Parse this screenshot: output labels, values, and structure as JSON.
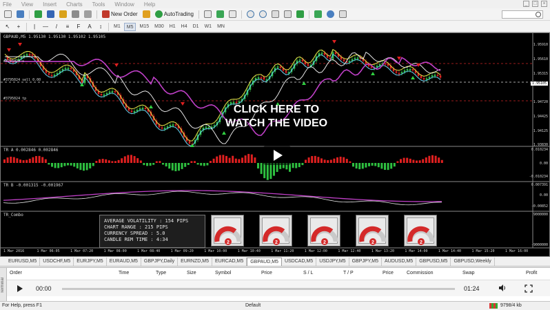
{
  "menu": [
    "File",
    "View",
    "Insert",
    "Charts",
    "Tools",
    "Window",
    "Help"
  ],
  "toolbar": {
    "new_order": "New Order",
    "auto_trading": "AutoTrading",
    "timeframes": [
      "M1",
      "M5",
      "M15",
      "M30",
      "H1",
      "H4",
      "D1",
      "W1",
      "MN"
    ]
  },
  "chart": {
    "title": "GBPAUD,M5 1.95130 1.95130 1.95102 1.95105",
    "order_labels": [
      "#3795024 s",
      "#3795024 sell 0.00",
      "#3795024 tp"
    ],
    "price_axis": [
      "1.95910",
      "1.95610",
      "1.95315",
      "1.95105",
      "1.94720",
      "1.94425",
      "1.94125",
      "1.93830"
    ],
    "current_price": "1.95105",
    "x_axis": [
      "1 Mar 2016",
      "1 Mar 06:05",
      "1 Mar 07:20",
      "1 Mar 08:00",
      "1 Mar 08:40",
      "1 Mar 09:20",
      "1 Mar 10:00",
      "1 Mar 10:40",
      "1 Mar 11:20",
      "1 Mar 12:00",
      "1 Mar 12:40",
      "1 Mar 13:20",
      "1 Mar 14:00",
      "1 Mar 14:40",
      "1 Mar 15:20",
      "1 Mar 16:00"
    ],
    "tr_a": {
      "label": "TR A 0.002846 0.002846",
      "axis": [
        "0.010234",
        "0.00",
        "-0.010234"
      ]
    },
    "tr_b": {
      "label": "TR B -0.001315 -0.001967",
      "axis": [
        "0.007391",
        "0.00",
        "-0.00852"
      ]
    },
    "tr_combo": {
      "label": "TR_Combo",
      "axis": [
        "9000000",
        "-9000000"
      ]
    },
    "stats": [
      "AVERAGE VOLATILITY : 154 PIPS",
      "CHART RANGE : 215 PIPS",
      "CURRENCY SPREAD : 5.0",
      "CANDLE REM TIME : 4:34"
    ],
    "gauge_value": "2"
  },
  "video": {
    "overlay_line1": "CLICK HERE TO",
    "overlay_line2": "WATCH THE VIDEO",
    "current_time": "00:00",
    "duration": "01:24"
  },
  "tabs": [
    "EURUSD,M5",
    "USDCHF,M5",
    "EURJPY,M5",
    "EURAUD,M5",
    "GBPJPY,Daily",
    "EURNZD,M5",
    "EURCAD,M5",
    "GBPAUD,M5",
    "USDCAD,M5",
    "USDJPY,M5",
    "GBPJPY,M5",
    "AUDUSD,M5",
    "GBPUSD,M5",
    "GBPUSD,Weekly"
  ],
  "active_tab": "GBPAUD,M5",
  "terminal": {
    "side_label": "Terminal",
    "columns": [
      "Order",
      "Time",
      "Type",
      "Size",
      "Symbol",
      "Price",
      "S / L",
      "T / P",
      "Price",
      "Commission",
      "Swap",
      "Profit"
    ]
  },
  "status": {
    "help": "For Help, press F1",
    "profile": "Default",
    "traffic": "9798/4 kb"
  }
}
